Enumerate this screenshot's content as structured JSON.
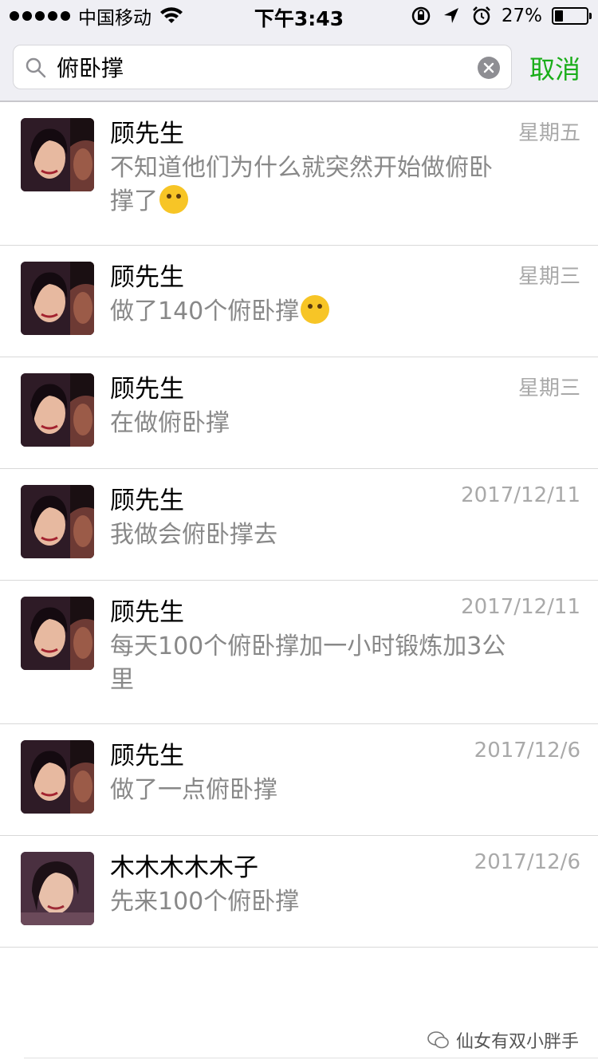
{
  "status_bar": {
    "carrier": "中国移动",
    "time": "下午3:43",
    "battery": "27%",
    "battery_level": 0.27
  },
  "search": {
    "query": "俯卧撑",
    "cancel_label": "取消"
  },
  "results": [
    {
      "name": "顾先生",
      "time": "星期五",
      "message_line1": "不知道他们为什么就突然开始做俯卧",
      "message_line2": "撑了",
      "emoji": "laughing-crying"
    },
    {
      "name": "顾先生",
      "time": "星期三",
      "message_line1": "做了140个俯卧撑",
      "emoji": "cool-face"
    },
    {
      "name": "顾先生",
      "time": "星期三",
      "message_line1": "在做俯卧撑"
    },
    {
      "name": "顾先生",
      "time": "2017/12/11",
      "message_line1": "我做会俯卧撑去"
    },
    {
      "name": "顾先生",
      "time": "2017/12/11",
      "message_line1": "每天100个俯卧撑加一小时锻炼加3公",
      "message_line2": "里"
    },
    {
      "name": "顾先生",
      "time": "2017/12/6",
      "message_line1": "做了一点俯卧撑"
    },
    {
      "name": "木木木木木子",
      "time": "2017/12/6",
      "message_line1": "先来100个俯卧撑"
    }
  ],
  "watermark": "仙女有双小胖手"
}
